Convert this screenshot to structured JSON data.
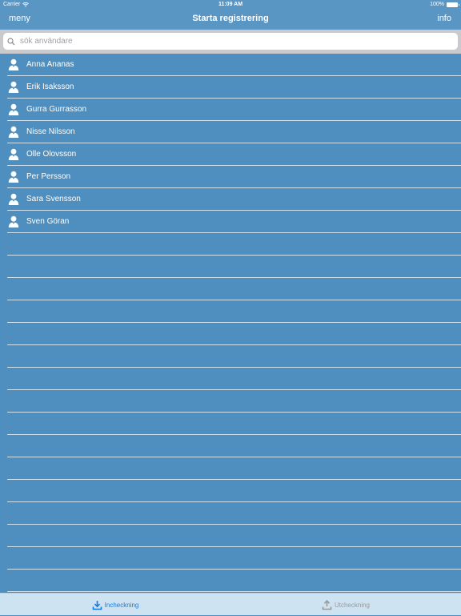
{
  "status_bar": {
    "carrier": "Carrier",
    "time": "11:09 AM",
    "battery": "100%"
  },
  "nav": {
    "left": "meny",
    "title": "Starta registrering",
    "right": "info"
  },
  "search": {
    "placeholder": "sök användare",
    "value": ""
  },
  "users": [
    {
      "name": "Anna Ananas"
    },
    {
      "name": "Erik Isaksson"
    },
    {
      "name": "Gurra Gurrasson"
    },
    {
      "name": "Nisse Nilsson"
    },
    {
      "name": "Olle Olovsson"
    },
    {
      "name": "Per Persson"
    },
    {
      "name": "Sara Svensson"
    },
    {
      "name": "Sven Göran"
    }
  ],
  "tabs": [
    {
      "label": "Incheckning",
      "icon": "download-icon",
      "active": true
    },
    {
      "label": "Utcheckning",
      "icon": "upload-icon",
      "active": false
    }
  ],
  "colors": {
    "background": "#4f8fbf",
    "bars": "#5a96c4",
    "tab_active": "#1a7ad6",
    "tab_inactive": "#9a9a9a"
  }
}
